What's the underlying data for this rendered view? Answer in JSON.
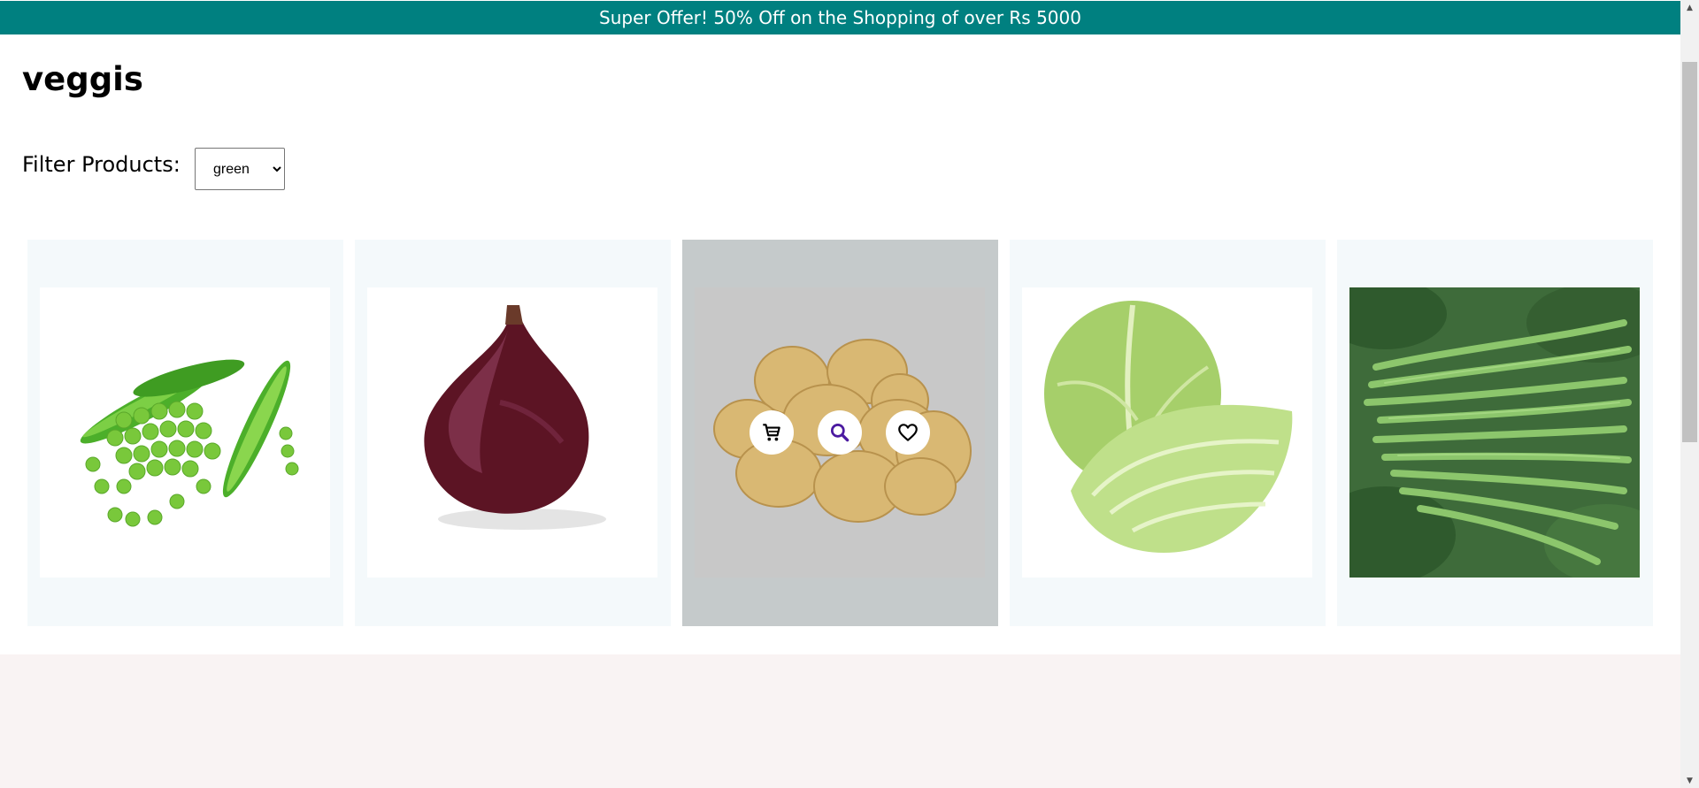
{
  "offer_banner": "Super Offer! 50% Off on the Shopping of over Rs 5000",
  "page_title": "veggis",
  "filter": {
    "label": "Filter Products:",
    "selected": "green"
  },
  "products": [
    {
      "name": "peas",
      "image_icon": "peas-image"
    },
    {
      "name": "red-onion",
      "image_icon": "onion-image"
    },
    {
      "name": "potatoes",
      "image_icon": "potato-image",
      "hovered": true
    },
    {
      "name": "cabbage",
      "image_icon": "cabbage-image"
    },
    {
      "name": "green-beans",
      "image_icon": "beans-image"
    }
  ],
  "actions": {
    "cart_icon": "cart-icon",
    "search_icon": "search-icon",
    "heart_icon": "heart-icon"
  },
  "colors": {
    "banner": "#008080",
    "card_bg": "#f4f9fb",
    "card_hover_bg": "#c5cacb",
    "footer_bg": "#f9f3f3",
    "search_icon": "#4b1aa0"
  }
}
